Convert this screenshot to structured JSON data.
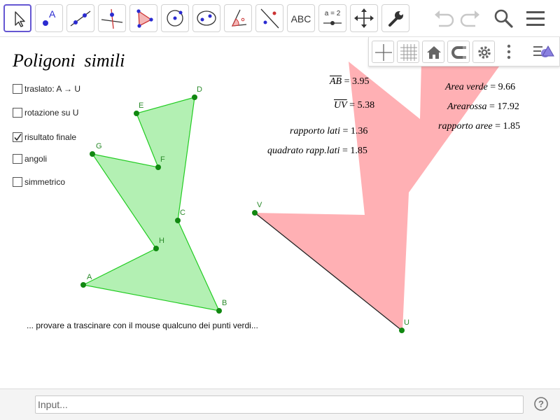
{
  "toolbar": {
    "tools": [
      {
        "name": "move-tool-icon"
      },
      {
        "name": "point-tool-icon",
        "letter": "A"
      },
      {
        "name": "line-tool-icon"
      },
      {
        "name": "perpendicular-tool-icon"
      },
      {
        "name": "polygon-tool-icon"
      },
      {
        "name": "circle-tool-icon"
      },
      {
        "name": "ellipse-tool-icon"
      },
      {
        "name": "angle-tool-icon"
      },
      {
        "name": "reflect-tool-icon"
      },
      {
        "name": "text-tool-icon",
        "label": "ABC"
      },
      {
        "name": "slider-tool-icon",
        "label": "a = 2"
      },
      {
        "name": "move-view-tool-icon"
      },
      {
        "name": "tools-wrench-icon"
      }
    ],
    "right": [
      "undo-icon",
      "redo-icon",
      "search-icon",
      "menu-icon"
    ]
  },
  "stylebar": {
    "items": [
      "axes-icon",
      "grid-icon",
      "home-icon",
      "magnet-icon",
      "settings-icon",
      "more-icon",
      "views-icon"
    ]
  },
  "graphics": {
    "title": "Poligoni  simili",
    "checkboxes": [
      {
        "label": "traslato: A → U",
        "checked": false
      },
      {
        "label": "rotazione su U",
        "checked": false
      },
      {
        "label": "risultato finale",
        "checked": true
      },
      {
        "label": "angoli",
        "checked": false
      },
      {
        "label": "simmetrico",
        "checked": false
      }
    ],
    "measures": {
      "ab_label": "AB",
      "ab_value": " = 3.95",
      "uv_label": "UV",
      "uv_value": " = 5.38",
      "ratio_sides_label": "rapporto lati",
      "ratio_sides_value": " = 1.36",
      "square_ratio_label": "quadrato rapp.lati",
      "square_ratio_value": " = 1.85",
      "green_area_label": "Area verde",
      "green_area_value": " = 9.66",
      "red_area_label": "Arearossa",
      "red_area_value": " = 17.92",
      "ratio_areas_label": "rapporto  aree",
      "ratio_areas_value": " = 1.85"
    },
    "points": {
      "A": "A",
      "B": "B",
      "C": "C",
      "D": "D",
      "E": "E",
      "F": "F",
      "G": "G",
      "H": "H",
      "U": "U",
      "V": "V"
    },
    "hint": "... provare a trascinare con il mouse qualcuno dei punti verdi...",
    "colors": {
      "green_fill": "#b3f0b3",
      "green_stroke": "#22cc22",
      "red_fill": "#ffb0b4",
      "point": "#118811",
      "accent": "#6557d2"
    }
  },
  "inputbar": {
    "placeholder": "Input..."
  }
}
